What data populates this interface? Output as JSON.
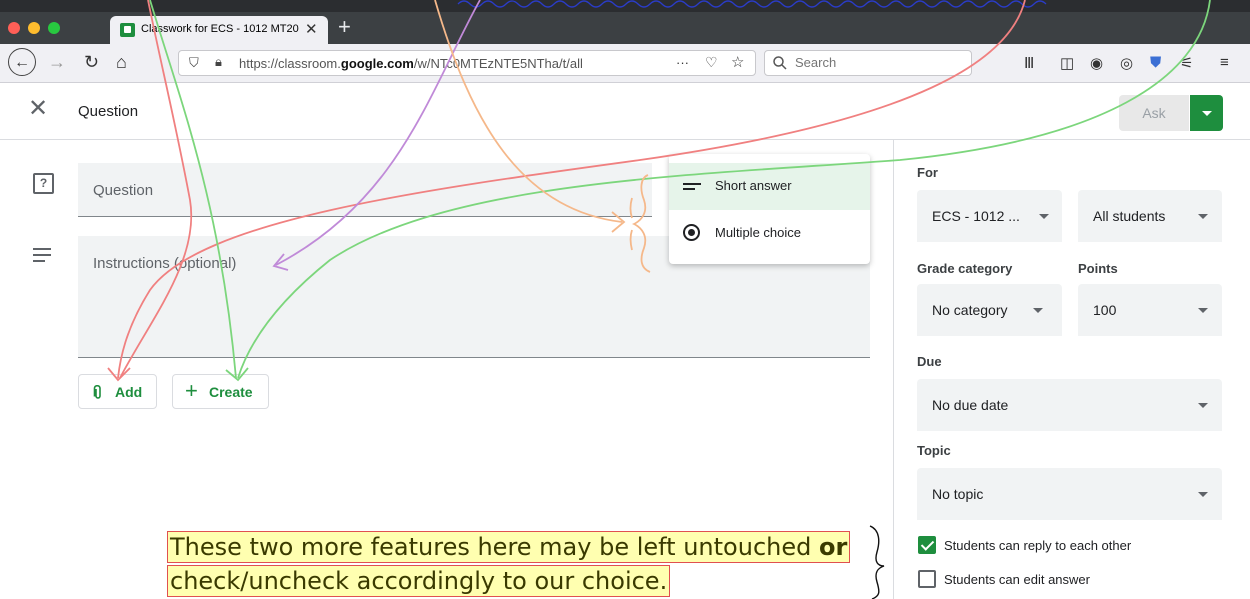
{
  "browser": {
    "tab_title": "Classwork for ECS - 1012 MT20",
    "tab_close": "✕",
    "new_tab": "+",
    "url_prefix": "https://classroom.",
    "url_domain": "google.com",
    "url_path": "/w/NTc0MTEzNTE5NTha/t/all",
    "url_more": "···",
    "search_placeholder": "Search"
  },
  "header": {
    "close": "✕",
    "title": "Question",
    "ask_label": "Ask"
  },
  "form": {
    "question_placeholder": "Question",
    "instructions_placeholder": "Instructions (optional)",
    "add_label": "Add",
    "create_label": "Create"
  },
  "question_type_menu": {
    "items": [
      {
        "label": "Short answer",
        "icon": "short-answer-icon",
        "selected": true
      },
      {
        "label": "Multiple choice",
        "icon": "radio-icon",
        "selected": false
      }
    ]
  },
  "sidebar": {
    "for_label": "For",
    "class_value": "ECS - 1012 ...",
    "students_value": "All students",
    "grade_category_label": "Grade category",
    "grade_category_value": "No category",
    "points_label": "Points",
    "points_value": "100",
    "due_label": "Due",
    "due_value": "No due date",
    "topic_label": "Topic",
    "topic_value": "No topic",
    "reply_label": "Students can reply to each other",
    "reply_checked": true,
    "edit_label": "Students can edit answer",
    "edit_checked": false
  },
  "annotation": {
    "line1_before": "These two more features here may be left untouched ",
    "line1_bold": "or",
    "line2": "check/uncheck accordingly to our choice."
  },
  "colors": {
    "accent_green": "#1e8e3e",
    "arrow_red": "#f08080",
    "arrow_green": "#7cd67c",
    "arrow_purple": "#c08ad8",
    "arrow_orange": "#f5b88a",
    "highlight": "#ffffb0"
  }
}
